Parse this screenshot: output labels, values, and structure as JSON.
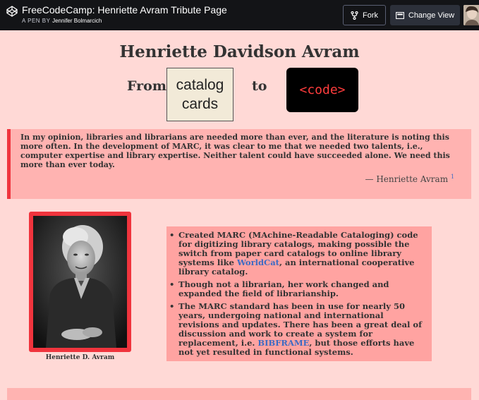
{
  "topbar": {
    "title": "FreeCodeCamp: Henriette Avram Tribute Page",
    "byline_prefix": "A PEN BY",
    "author": "Jennifer Bolmarcich",
    "fork_label": "Fork",
    "change_view_label": "Change View"
  },
  "header": {
    "title": "Henriette Davidson Avram",
    "from_label": "From",
    "catalog_line1": "catalog",
    "catalog_line2": "cards",
    "to_label": "to",
    "code_label": "<code>"
  },
  "quote": {
    "text": "In my opinion, libraries and librarians are needed more than ever, and the literature is noting this more often. In the development of MARC, it was clear to me that we needed two talents, i.e., computer expertise and library expertise. Neither talent could have succeeded alone. We need this more than ever today.",
    "attribution": "— Henriette Avram",
    "footnote": "1"
  },
  "photo": {
    "caption": "Henriette D. Avram"
  },
  "facts": {
    "item1_a": "Created MARC (",
    "item1_b": "MA",
    "item1_c": "chine-",
    "item1_d": "R",
    "item1_e": "eadable ",
    "item1_f": "C",
    "item1_g": "ataloging) code for digitizing library catalogs, making possible the switch from paper card catalogs to online library systems like ",
    "item1_link": "WorldCat",
    "item1_end": ", an international cooperative library catalog.",
    "item2": "Though not a librarian, her work changed and expanded the field of librarianship.",
    "item3_a": "The MARC standard has been in use for nearly 50 years, undergoing national and international revisions and updates. There has been a great deal of discussion and work to create a system for replacement, i.e. ",
    "item3_link": "BIBFRAME",
    "item3_end": ", but those efforts have not yet resulted in functional systems."
  },
  "colors": {
    "page_bg": "#ffd9d6",
    "accent_red": "#f0343d",
    "quote_bg": "#ffb3b1",
    "facts_bg": "#ffa3a1",
    "link": "#3d6bc4",
    "code_text": "#ff3d3d"
  },
  "icons": {
    "logo": "codepen-logo-icon",
    "fork": "fork-icon",
    "change_view": "layout-icon"
  }
}
